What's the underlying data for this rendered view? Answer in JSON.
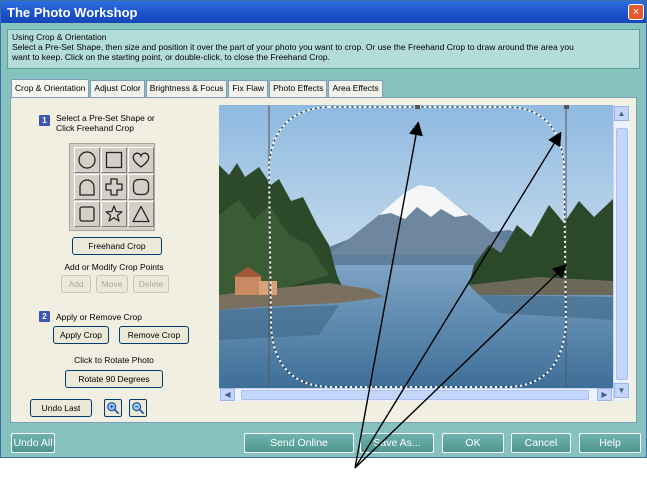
{
  "window": {
    "title": "The Photo Workshop",
    "close_glyph": "×"
  },
  "instructions": {
    "heading": "Using Crop & Orientation",
    "line1": "Select a Pre-Set Shape, then size and position it over the part of your photo you want to crop.  Or use the Freehand Crop to draw around the area you",
    "line2": "want to keep.  Click on the starting point, or double-click, to close the Freehand Crop."
  },
  "tabs": [
    {
      "label": "Crop & Orientation",
      "active": true
    },
    {
      "label": "Adjust Color"
    },
    {
      "label": "Brightness & Focus"
    },
    {
      "label": "Fix Flaw"
    },
    {
      "label": "Photo Effects"
    },
    {
      "label": "Area Effects"
    }
  ],
  "left_panel": {
    "step1_number": "1",
    "step1_line1": "Select a Pre-Set Shape or",
    "step1_line2": "Click Freehand Crop",
    "shapes": [
      "circle-icon",
      "square-icon",
      "heart-icon",
      "arch-icon",
      "cross-icon",
      "rounded-square-icon",
      "small-square-icon",
      "star-icon",
      "triangle-icon"
    ],
    "freehand_crop": "Freehand Crop",
    "crop_points_label": "Add or Modify Crop Points",
    "add": "Add",
    "move": "Move",
    "delete": "Delete",
    "step2_number": "2",
    "step2_label": "Apply or Remove Crop",
    "apply_crop": "Apply Crop",
    "remove_crop": "Remove Crop",
    "rotate_label": "Click to Rotate Photo",
    "rotate_button": "Rotate 90 Degrees",
    "undo_last": "Undo Last",
    "zoom_in_icon": "zoom-in-icon",
    "zoom_out_icon": "zoom-out-icon"
  },
  "bottom": {
    "undo_all": "Undo All",
    "send_online": "Send Online",
    "save_as": "Save As...",
    "ok": "OK",
    "cancel": "Cancel",
    "help": "Help"
  },
  "colors": {
    "window_bg": "#86c3be",
    "title_bar": "#1a50c8",
    "panel_bg": "#f1efe2"
  }
}
